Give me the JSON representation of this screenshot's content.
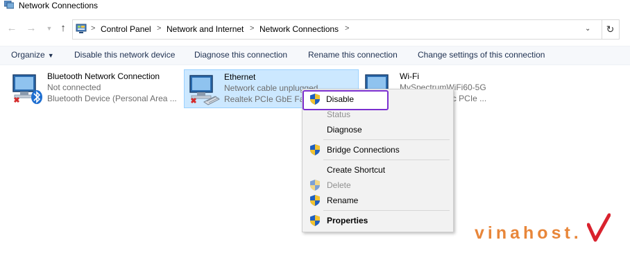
{
  "window": {
    "title": "Network Connections"
  },
  "address": {
    "crumbs": [
      "Control Panel",
      "Network and Internet",
      "Network Connections"
    ]
  },
  "toolbar": {
    "organize": "Organize",
    "disable": "Disable this network device",
    "diagnose": "Diagnose this connection",
    "rename": "Rename this connection",
    "change": "Change settings of this connection"
  },
  "connections": [
    {
      "name": "Bluetooth Network Connection",
      "status": "Not connected",
      "device": "Bluetooth Device (Personal Area ..."
    },
    {
      "name": "Ethernet",
      "status": "Network cable unplugged",
      "device": "Realtek PCIe GbE Fam"
    },
    {
      "name": "Wi-Fi",
      "status": "MySpectrumWiFi60-5G",
      "device": "21CE 802.11ac PCIe ..."
    }
  ],
  "context_menu": {
    "items": [
      {
        "label": "Disable",
        "shield": true,
        "enabled": true
      },
      {
        "label": "Status",
        "shield": false,
        "enabled": false
      },
      {
        "label": "Diagnose",
        "shield": false,
        "enabled": true
      },
      {
        "label": "Bridge Connections",
        "shield": true,
        "enabled": true
      },
      {
        "label": "Create Shortcut",
        "shield": false,
        "enabled": true
      },
      {
        "label": "Delete",
        "shield": true,
        "enabled": false
      },
      {
        "label": "Rename",
        "shield": true,
        "enabled": true
      },
      {
        "label": "Properties",
        "shield": true,
        "enabled": true
      }
    ]
  },
  "watermark": {
    "text": "vinahost."
  },
  "colors": {
    "highlight": "#7b2fcf",
    "selection": "#cce8ff",
    "brand": "#e8863a",
    "brand_mark": "#d9232e"
  }
}
